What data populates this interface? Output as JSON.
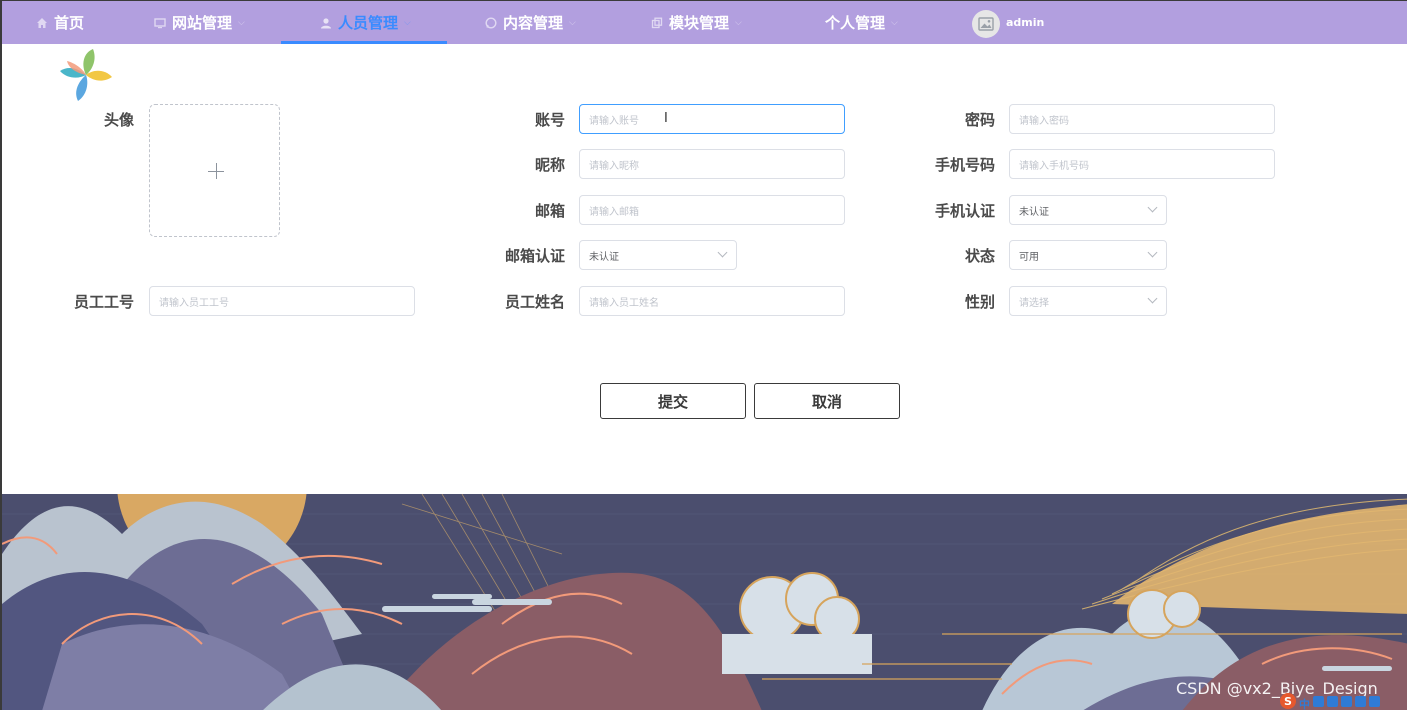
{
  "nav": {
    "items": [
      {
        "label": "首页",
        "icon": "home-icon"
      },
      {
        "label": "网站管理",
        "icon": "monitor-icon"
      },
      {
        "label": "人员管理",
        "icon": "user-icon",
        "active": true
      },
      {
        "label": "内容管理",
        "icon": "chat-icon"
      },
      {
        "label": "模块管理",
        "icon": "copy-icon"
      },
      {
        "label": "个人管理",
        "icon": ""
      }
    ],
    "user": "admin",
    "active_color": "#3a8bff",
    "bar_color": "#b29fdf"
  },
  "form": {
    "avatar_label": "头像",
    "account": {
      "label": "账号",
      "placeholder": "请输入账号"
    },
    "password": {
      "label": "密码",
      "placeholder": "请输入密码"
    },
    "nickname": {
      "label": "昵称",
      "placeholder": "请输入昵称"
    },
    "phone": {
      "label": "手机号码",
      "placeholder": "请输入手机号码"
    },
    "email": {
      "label": "邮箱",
      "placeholder": "请输入邮箱"
    },
    "phone_verify": {
      "label": "手机认证",
      "value": "未认证"
    },
    "email_verify": {
      "label": "邮箱认证",
      "value": "未认证"
    },
    "status": {
      "label": "状态",
      "value": "可用"
    },
    "employee_no": {
      "label": "员工工号",
      "placeholder": "请输入员工工号"
    },
    "employee_name": {
      "label": "员工姓名",
      "placeholder": "请输入员工姓名"
    },
    "gender": {
      "label": "性别",
      "placeholder": "请选择"
    }
  },
  "buttons": {
    "submit": "提交",
    "cancel": "取消"
  },
  "watermark": "CSDN @vx2_Biye_Design",
  "tray": {
    "ime": "中"
  }
}
